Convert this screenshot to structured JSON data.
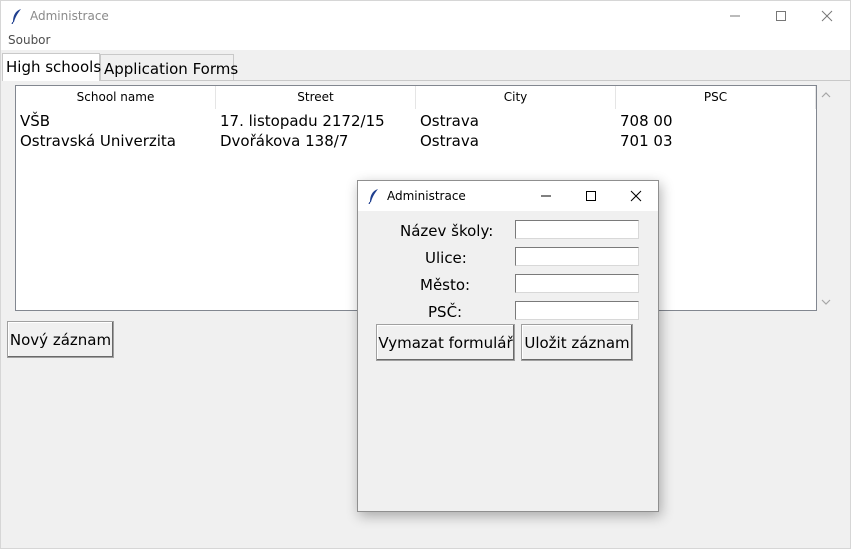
{
  "window": {
    "title": "Administrace",
    "controls": [
      "minimize-icon",
      "maximize-icon",
      "close-icon"
    ]
  },
  "menubar": {
    "items": [
      "Soubor"
    ]
  },
  "tabs": [
    {
      "label": "High schools",
      "active": true
    },
    {
      "label": "Application Forms",
      "active": false
    }
  ],
  "table": {
    "columns": [
      "School name",
      "Street",
      "City",
      "PSC"
    ],
    "rows": [
      [
        "VŠB",
        "17. listopadu 2172/15",
        "Ostrava",
        "708 00"
      ],
      [
        "Ostravská Univerzita",
        "Dvořákova 138/7",
        "Ostrava",
        "701 03"
      ]
    ]
  },
  "new_record_label": "Nový záznam",
  "dialog": {
    "title": "Administrace",
    "fields": [
      {
        "label": "Název školy:",
        "value": ""
      },
      {
        "label": "Ulice:",
        "value": ""
      },
      {
        "label": "Město:",
        "value": ""
      },
      {
        "label": "PSČ:",
        "value": ""
      }
    ],
    "clear_label": "Vymazat formulář",
    "save_label": "Uložit záznam"
  }
}
